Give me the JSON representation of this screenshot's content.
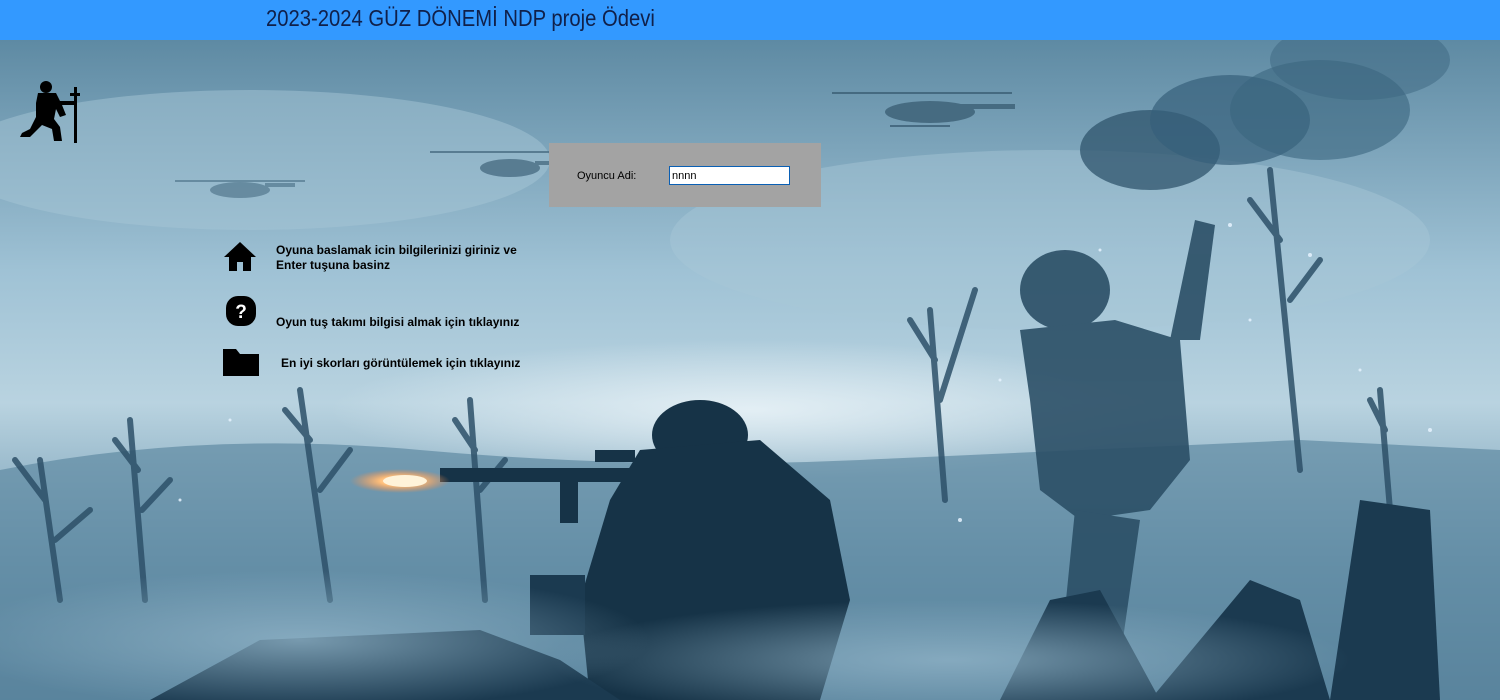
{
  "window": {
    "title": "2023-2024 GÜZ DÖNEMİ NDP proje Ödevi"
  },
  "login": {
    "player_label": "Oyuncu Adi:",
    "player_name_value": "nnnn"
  },
  "menu": {
    "start": {
      "icon": "home-icon",
      "line1": "Oyuna baslamak icin bilgilerinizi giriniz ve",
      "line2": "Enter tuşuna basinz"
    },
    "help": {
      "icon": "question-icon",
      "label": "Oyun tuş takımı bilgisi almak için tıklayınız"
    },
    "scores": {
      "icon": "folder-icon",
      "label": "En iyi skorları görüntülemek için tıklayınız"
    }
  },
  "logo": {
    "icon": "kneeling-soldier-icon"
  },
  "colors": {
    "title_bar": "#3399ff",
    "panel": "#a3a3a3",
    "scene_sky": "#9cc0d4",
    "scene_shadow": "#1d3d55"
  }
}
